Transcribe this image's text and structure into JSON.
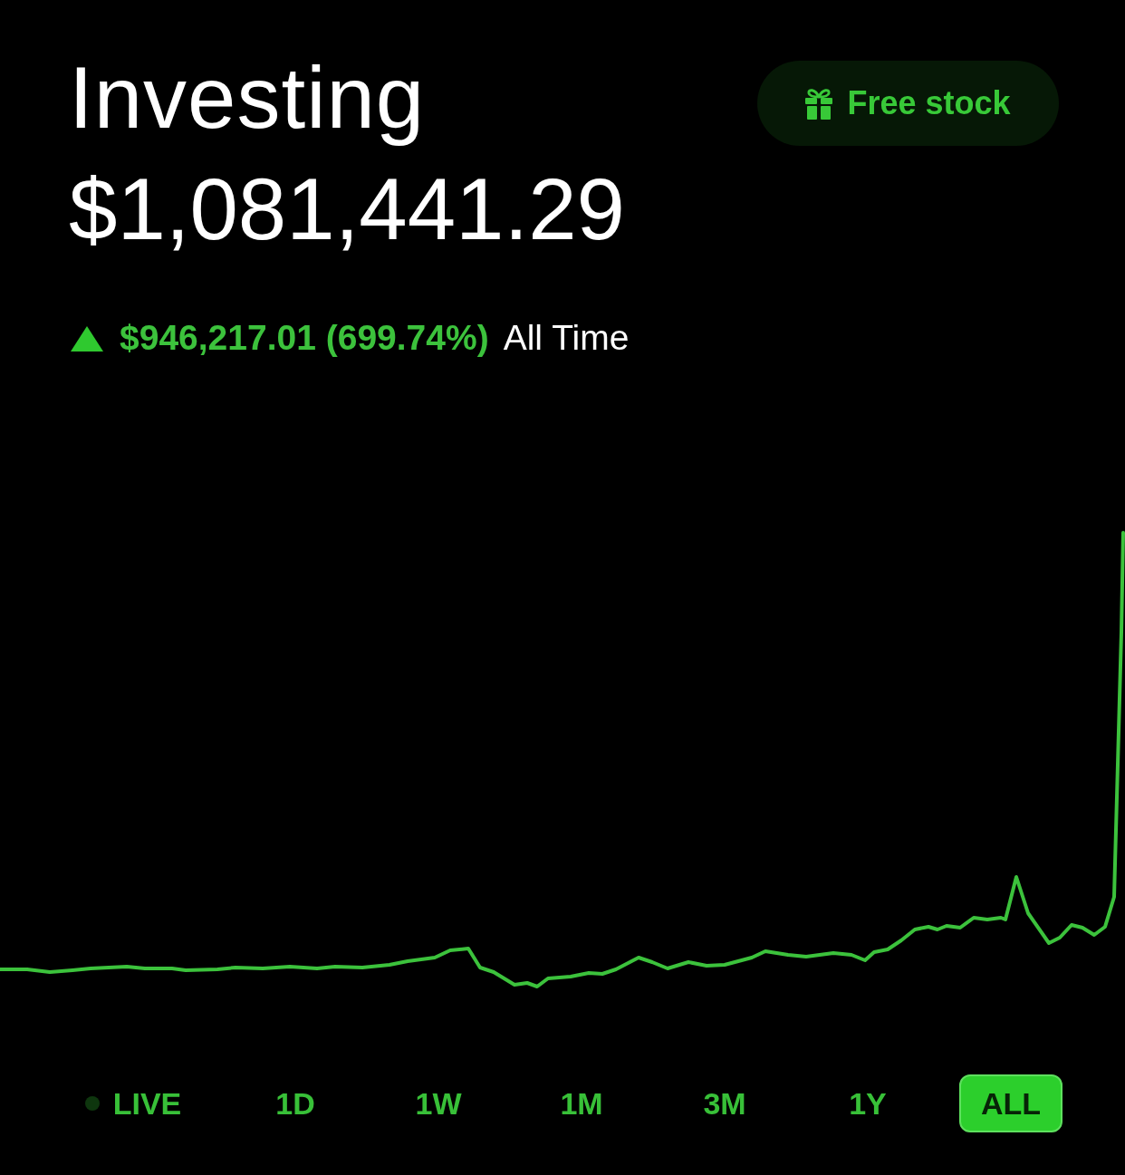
{
  "header": {
    "title": "Investing",
    "balance": "$1,081,441.29"
  },
  "free_stock_button": {
    "label": "Free stock"
  },
  "change": {
    "positive": true,
    "amount": "$946,217.01 (699.74%)",
    "period": "All Time"
  },
  "ranges": [
    {
      "label": "LIVE",
      "kind": "live",
      "selected": false
    },
    {
      "label": "1D",
      "kind": "range",
      "selected": false
    },
    {
      "label": "1W",
      "kind": "range",
      "selected": false
    },
    {
      "label": "1M",
      "kind": "range",
      "selected": false
    },
    {
      "label": "3M",
      "kind": "range",
      "selected": false
    },
    {
      "label": "1Y",
      "kind": "range",
      "selected": false
    },
    {
      "label": "ALL",
      "kind": "range",
      "selected": true
    }
  ]
}
